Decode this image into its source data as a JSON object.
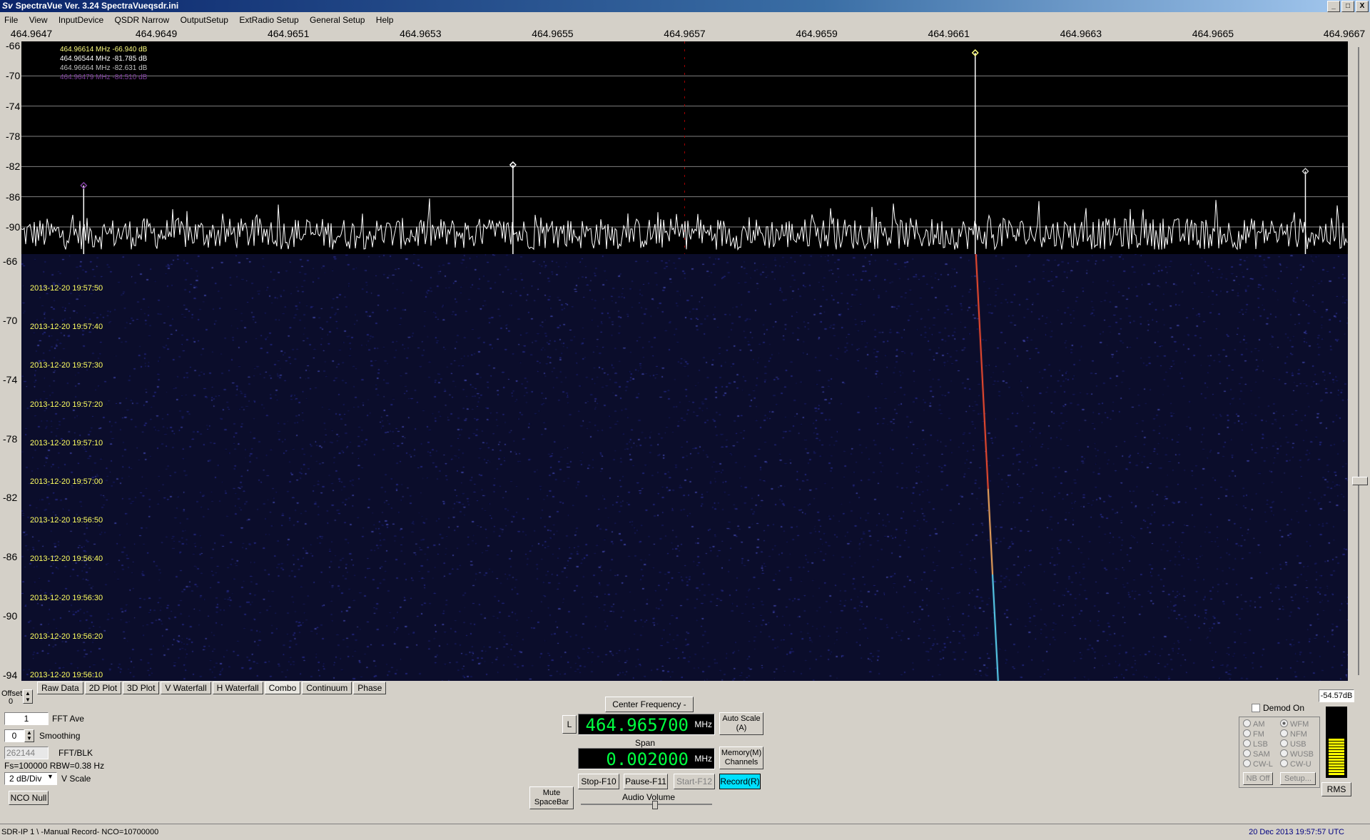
{
  "window": {
    "logo": "Sv",
    "title": "SpectraVue Ver. 3.24  SpectraVueqsdr.ini",
    "controls": [
      "_",
      "□",
      "X"
    ]
  },
  "menu": [
    "File",
    "View",
    "InputDevice",
    "QSDR Narrow",
    "OutputSetup",
    "ExtRadio Setup",
    "General Setup",
    "Help"
  ],
  "freq_axis": [
    "464.9647",
    "464.9649",
    "464.9651",
    "464.9653",
    "464.9655",
    "464.9657",
    "464.9659",
    "464.9661",
    "464.9663",
    "464.9665",
    "464.9667"
  ],
  "spectrum": {
    "db_ticks": [
      "-66",
      "-70",
      "-74",
      "-78",
      "-82",
      "-86",
      "-90"
    ],
    "db_range": [
      -66,
      -94
    ],
    "peaks": [
      {
        "label": "464.96614 MHz  -66.940 dB",
        "freq": 464.96614,
        "db": -66.94,
        "color": "#ffff80"
      },
      {
        "label": "464.96544 MHz  -81.785 dB",
        "freq": 464.96544,
        "db": -81.785,
        "color": "#ffffff"
      },
      {
        "label": "464.96664 MHz  -82.631 dB",
        "freq": 464.96664,
        "db": -82.631,
        "color": "#c0c0c0"
      },
      {
        "label": "464.96479 MHz  -84.510 dB",
        "freq": 464.96479,
        "db": -84.51,
        "color": "#8040a0"
      }
    ]
  },
  "waterfall": {
    "db_ticks": [
      "-66",
      "-70",
      "-74",
      "-78",
      "-82",
      "-86",
      "-90",
      "-94"
    ],
    "timestamps": [
      "2013-12-20 19:57:50",
      "2013-12-20 19:57:40",
      "2013-12-20 19:57:30",
      "2013-12-20 19:57:20",
      "2013-12-20 19:57:10",
      "2013-12-20 19:57:00",
      "2013-12-20 19:56:50",
      "2013-12-20 19:56:40",
      "2013-12-20 19:56:30",
      "2013-12-20 19:56:20",
      "2013-12-20 19:56:10"
    ]
  },
  "tabs": [
    "Raw Data",
    "2D Plot",
    "3D Plot",
    "V Waterfall",
    "H Waterfall",
    "Combo",
    "Continuum",
    "Phase"
  ],
  "active_tab": "Combo",
  "left_controls": {
    "offset_label": "Offset",
    "offset_value": "0",
    "fft_ave_value": "1",
    "fft_ave_label": "FFT Ave",
    "smoothing_value": "0",
    "smoothing_label": "Smoothing",
    "fft_blk_value": "262144",
    "fft_blk_label": "FFT/BLK",
    "fs_info": "Fs=100000 RBW=0.38 Hz",
    "vscale_value": "2 dB/Div",
    "vscale_label": "V Scale",
    "nco_null": "NCO Null"
  },
  "center": {
    "center_freq_btn": "Center Frequency - Ins",
    "l_btn": "L",
    "freq_value": "464.965700",
    "freq_unit": "MHz",
    "span_label": "Span",
    "span_value": "0.002000",
    "span_unit": "MHz",
    "auto_scale": "Auto Scale (A)",
    "memory": "Memory(M) Channels",
    "stop": "Stop-F10",
    "pause": "Pause-F11",
    "start": "Start-F12",
    "record": "Record(R)",
    "mute": "Mute SpaceBar",
    "audio_volume": "Audio Volume"
  },
  "demod": {
    "demod_on": "Demod On",
    "modes_left": [
      "AM",
      "FM",
      "LSB",
      "SAM",
      "CW-L"
    ],
    "modes_right": [
      "WFM",
      "NFM",
      "USB",
      "WUSB",
      "CW-U"
    ],
    "nb_off": "NB Off",
    "setup": "Setup..."
  },
  "meter": {
    "value": "-54.57dB",
    "level": 0.55,
    "rms": "RMS"
  },
  "status": {
    "left": "SDR-IP 1  \\ -Manual Record-   NCO=10700000",
    "right": "20 Dec 2013   19:57:57 UTC"
  }
}
